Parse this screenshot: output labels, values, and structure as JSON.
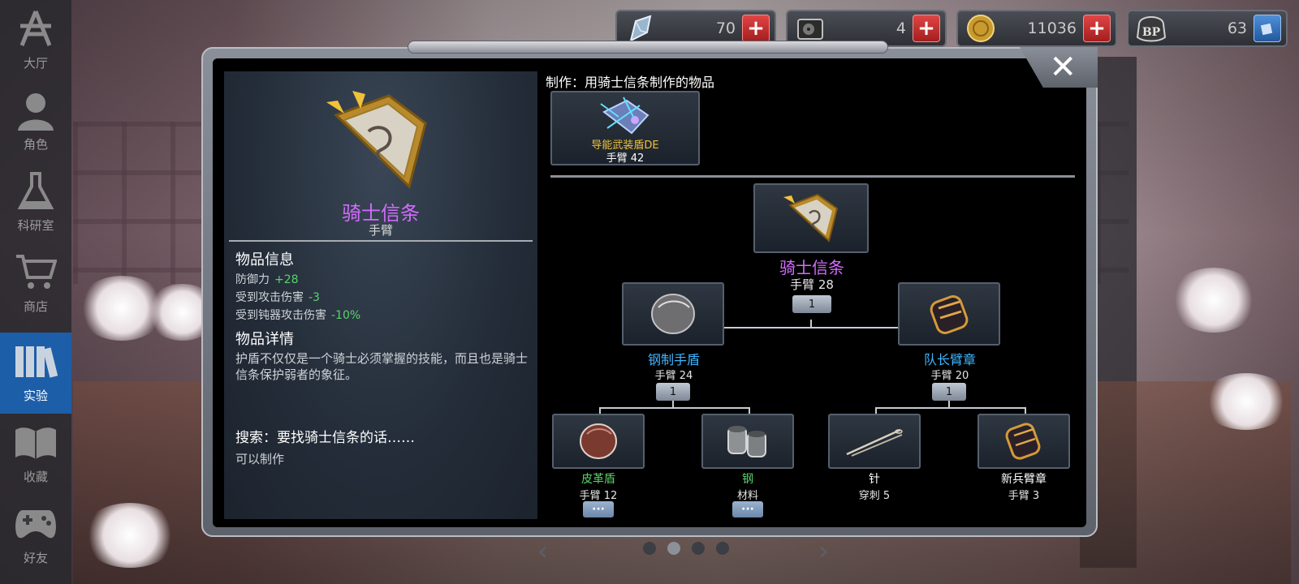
{
  "sidebar": {
    "items": [
      {
        "label": "大厅",
        "icon": "lobby-icon"
      },
      {
        "label": "角色",
        "icon": "character-icon"
      },
      {
        "label": "科研室",
        "icon": "flask-icon"
      },
      {
        "label": "商店",
        "icon": "cart-icon"
      },
      {
        "label": "实验",
        "icon": "books-icon",
        "active": true
      },
      {
        "label": "收藏",
        "icon": "open-book-icon"
      },
      {
        "label": "好友",
        "icon": "gamepad-icon"
      }
    ]
  },
  "resources": [
    {
      "icon": "crystal-icon",
      "value": "70"
    },
    {
      "icon": "disk-icon",
      "value": "4"
    },
    {
      "icon": "gold-coin-icon",
      "value": "11036"
    },
    {
      "icon": "bp-icon",
      "value": "63"
    }
  ],
  "item": {
    "name": "骑士信条",
    "type": "手臂",
    "info_title": "物品信息",
    "stats": [
      {
        "label": "防御力",
        "value": "+28"
      },
      {
        "label": "受到攻击伤害",
        "value": "-3"
      },
      {
        "label": "受到钝器攻击伤害",
        "value": "-10%"
      }
    ],
    "detail_title": "物品详情",
    "detail_text": "护盾不仅仅是一个骑士必须掌握的技能，而且也是骑士信条保护弱者的象征。",
    "search_title": "搜索：要找骑士信条的话……",
    "search_result": "可以制作"
  },
  "craft": {
    "heading": "制作：用骑士信条制作的物品",
    "product": {
      "name": "导能武装盾DE",
      "sub": "手臂 42"
    }
  },
  "tree": {
    "root": {
      "name": "骑士信条",
      "sub": "手臂 28",
      "qty": "1"
    },
    "left": {
      "name": "钢制手盾",
      "sub": "手臂 24",
      "qty": "1"
    },
    "right": {
      "name": "队长臂章",
      "sub": "手臂 20",
      "qty": "1"
    },
    "leaves": [
      {
        "name": "皮革盾",
        "sub": "手臂 12",
        "more": "···"
      },
      {
        "name": "钢",
        "sub": "材料",
        "more": "···"
      },
      {
        "name": "针",
        "sub": "穿刺 5"
      },
      {
        "name": "新兵臂章",
        "sub": "手臂 3"
      }
    ]
  },
  "colors": {
    "purple": "#d36bff",
    "blue": "#3fb4ff",
    "green": "#59d36a",
    "gold": "#f0c23a",
    "white": "#ffffff"
  },
  "pager": {
    "current": 2,
    "total": 4
  }
}
